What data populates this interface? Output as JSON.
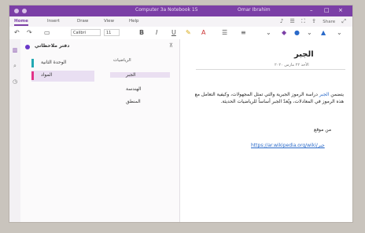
{
  "window": {
    "title": "Computer 3a Notebook 15",
    "user": "Omar Ibrahim"
  },
  "tabs": [
    "Home",
    "Insert",
    "Draw",
    "View",
    "Help"
  ],
  "tab_actions": {
    "share_label": "Share"
  },
  "ribbon": {
    "font_name": "Calibri",
    "font_size": "11"
  },
  "notebook": {
    "name": "دفتر ملاحظاتي"
  },
  "sections": [
    {
      "label": "الوحدة الثانية",
      "color": "#22a9b3"
    },
    {
      "label": "المواد",
      "color": "#e2338a"
    }
  ],
  "pages_header": "الرياضيات",
  "pages": [
    "الجبر",
    "الهندسة",
    "المنطق"
  ],
  "page": {
    "title": "الجبر",
    "date": "الأحد ٢٢ مارس ٢٠٢٠",
    "body_before_link": "يتضمن ",
    "body_link": "الجبر",
    "body_after_link": " دراسة الرموز الجبرية والتي تمثل المجهولات، وكيفية التعامل مع هذه الرموز في المعادلات، ويُعدّ الجبر أساساً للرياضيات الحديثة.",
    "ref_label": "من موقع",
    "url": "https://ar.wikipedia.org/wiki/جبر"
  }
}
